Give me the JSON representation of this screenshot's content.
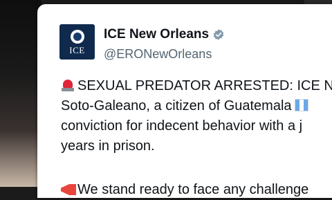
{
  "post": {
    "display_name": "ICE New Orleans",
    "handle": "@ERONewOrleans",
    "avatar_text": "ICE",
    "verified": true,
    "lines": [
      "SEXUAL PREDATOR ARRESTED: ICE N",
      "Soto-Galeano, a citizen of Guatemala",
      "conviction for indecent behavior with a j",
      "years in prison.",
      "We stand ready to face any challenge"
    ],
    "icons": {
      "line1": "police-siren-icon",
      "line2": "guatemala-flag-icon",
      "line5": "megaphone-icon"
    }
  },
  "colors": {
    "name": "#0f1419",
    "handle": "#536471",
    "verified_badge": "#829aab",
    "avatar_bg": "#0f2a4d"
  }
}
